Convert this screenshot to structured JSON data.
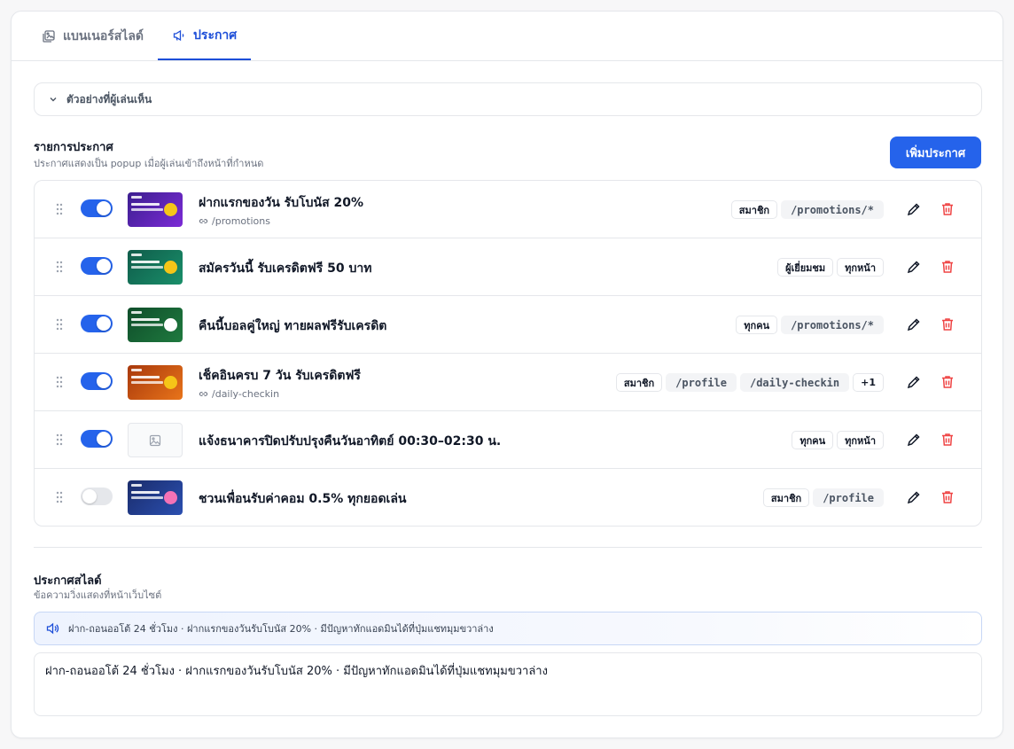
{
  "tabs": [
    {
      "label": "แบนเนอร์สไลด์",
      "icon": "image-stack-icon"
    },
    {
      "label": "ประกาศ",
      "icon": "megaphone-icon"
    }
  ],
  "preview": {
    "label": "ตัวอย่างที่ผู้เล่นเห็น"
  },
  "announcements": {
    "title": "รายการประกาศ",
    "subtitle": "ประกาศแสดงเป็น popup เมื่อผู้เล่นเข้าถึงหน้าที่กำหนด",
    "add_label": "เพิ่มประกาศ",
    "items": [
      {
        "title": "ฝากแรกของวัน รับโบนัส 20%",
        "link": "/promotions",
        "enabled": true,
        "badges": [
          "สมาชิก",
          "/promotions/*"
        ],
        "thumb_colors": [
          "#3b1e8f",
          "#7c2bd6"
        ],
        "coin": "#f5c518"
      },
      {
        "title": "สมัครวันนี้ รับเครดิตฟรี 50 บาท",
        "link": "",
        "enabled": true,
        "badges": [
          "ผู้เยี่ยมชม",
          "ทุกหน้า"
        ],
        "thumb_colors": [
          "#0f5c4a",
          "#1a8f6a"
        ],
        "coin": "#f5c518"
      },
      {
        "title": "คืนนี้บอลคู่ใหญ่ ทายผลฟรีรับเครดิต",
        "link": "",
        "enabled": true,
        "badges": [
          "ทุกคน",
          "/promotions/*"
        ],
        "thumb_colors": [
          "#0f4d2a",
          "#1f7a3f"
        ],
        "coin": "#ffffff"
      },
      {
        "title": "เช็คอินครบ 7 วัน รับเครดิตฟรี",
        "link": "/daily-checkin",
        "enabled": true,
        "badges": [
          "สมาชิก",
          "/profile",
          "/daily-checkin",
          "+1"
        ],
        "thumb_colors": [
          "#a8380c",
          "#e8741a"
        ],
        "coin": "#f5c518"
      },
      {
        "title": "แจ้งธนาคารปิดปรับปรุงคืนวันอาทิตย์ 00:30–02:30 น.",
        "link": "",
        "enabled": true,
        "badges": [
          "ทุกคน",
          "ทุกหน้า"
        ],
        "thumb_colors": [],
        "coin": ""
      },
      {
        "title": "ชวนเพื่อนรับค่าคอม 0.5% ทุกยอดเล่น",
        "link": "",
        "enabled": false,
        "badges": [
          "สมาชิก",
          "/profile"
        ],
        "thumb_colors": [
          "#1a2c6b",
          "#2b4fb0"
        ],
        "coin": "#f472b6"
      }
    ]
  },
  "ticker": {
    "title": "ประกาศสไลด์",
    "subtitle": "ข้อความวิ่งแสดงที่หน้าเว็บไซต์",
    "preview_text": "ฝาก-ถอนออโต้ 24 ชั่วโมง · ฝากแรกของวันรับโบนัส 20% · มีปัญหาทักแอดมินได้ที่ปุ่มแชทมุมขวาล่าง",
    "value": "ฝาก-ถอนออโต้ 24 ชั่วโมง · ฝากแรกของวันรับโบนัส 20% · มีปัญหาทักแอดมินได้ที่ปุ่มแชทมุมขวาล่าง"
  },
  "colors": {
    "accent": "#2563eb",
    "danger": "#ef4444"
  }
}
